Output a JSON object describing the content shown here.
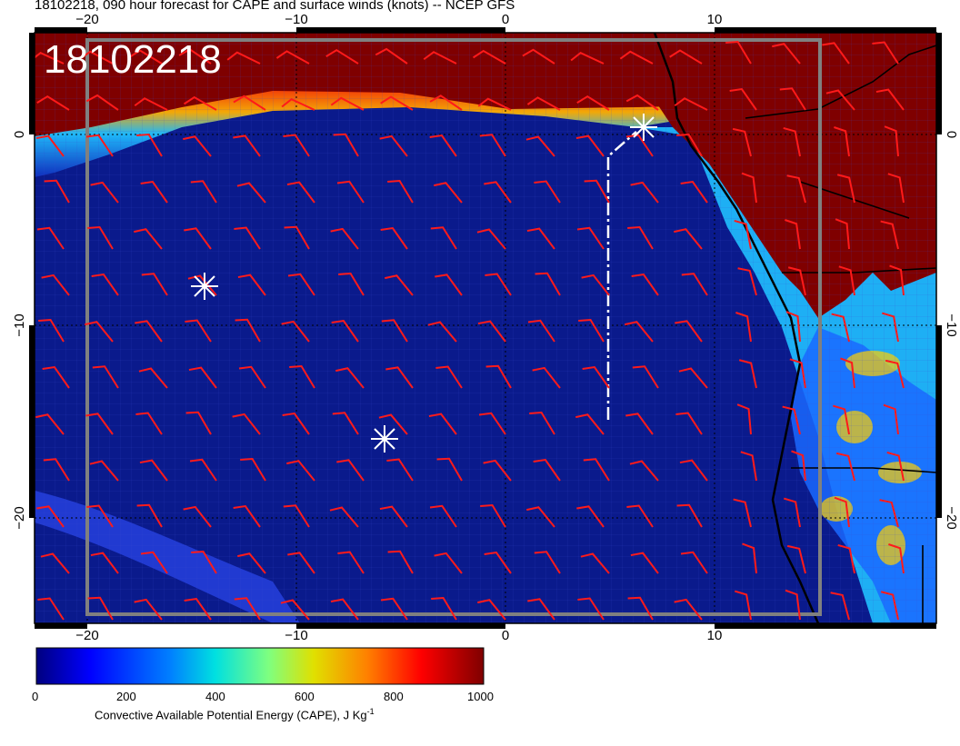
{
  "title": "18102218, 090 hour forecast for CAPE and surface winds (knots) -- NCEP GFS",
  "stamp": "18102218",
  "axes": {
    "lon_ticks": [
      "−20",
      "−10",
      "0",
      "10"
    ],
    "lat_ticks": [
      "0",
      "−10",
      "−20"
    ]
  },
  "colorbar": {
    "ticks": [
      "0",
      "200",
      "400",
      "600",
      "800",
      "1000"
    ],
    "title": "Convective Available Potential Energy (CAPE), J Kg",
    "title_sup": "-1",
    "colors": [
      "#00007f",
      "#0000ff",
      "#0080ff",
      "#00e0e0",
      "#7fff7f",
      "#e0e000",
      "#ff8000",
      "#ff0000",
      "#7f0000"
    ]
  },
  "colors": {
    "ocean": "#0a1a8c",
    "land": "#7f0000",
    "wind": "#ff1a1a",
    "marker": "#ffffff",
    "grid_box": "#808080"
  }
}
